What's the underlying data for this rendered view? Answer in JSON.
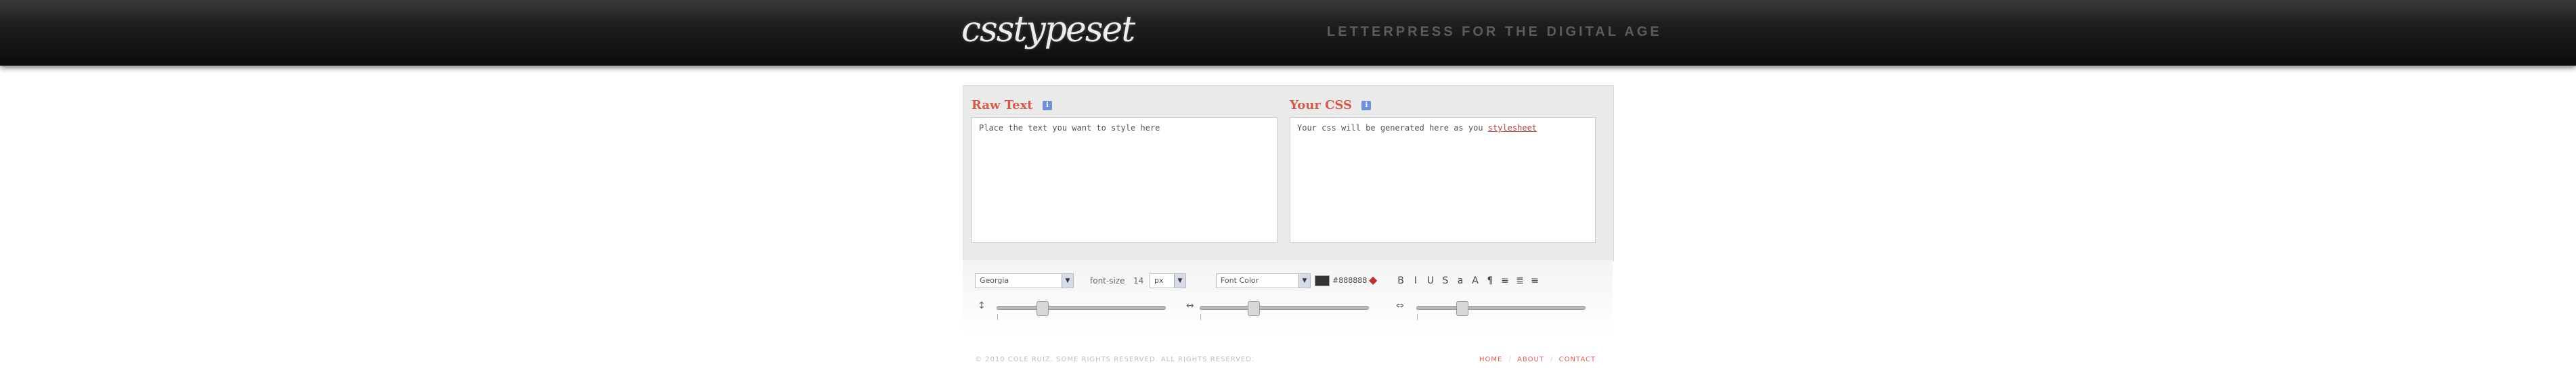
{
  "header": {
    "logo_text": "csstypeset",
    "tagline": "Letterpress for the digital age"
  },
  "editor": {
    "raw_label": "Raw Text",
    "raw_text": "Place the text you want to style here",
    "css_label": "Your CSS",
    "css_text_prefix": "Your css will be generated here as you",
    "css_text_link": "stylesheet",
    "help_icon": "info-icon"
  },
  "controls": {
    "font_family": "Georgia",
    "font_size_label": "font-size",
    "font_size_value": "14",
    "font_size_unit": "px",
    "text_color_select": "Font Color",
    "color_value": "#888888",
    "color_icon": "color-picker-icon",
    "format_buttons": [
      "B",
      "I",
      "U",
      "S",
      "a",
      "A",
      "¶",
      "≡",
      "≣",
      "≡"
    ],
    "slider1_icon": "line-height-icon",
    "slider2_icon": "letter-spacing-icon",
    "slider3_icon": "word-spacing-icon",
    "slider_levels": [
      0.25,
      0.3,
      0.25
    ]
  },
  "footer": {
    "copyright": "© 2010 Cole Ruiz. Some rights reserved. All rights reserved.",
    "links": [
      "Home",
      "About",
      "Contact"
    ]
  },
  "colors": {
    "accent_red": "#d65a4a",
    "header_dark": "#0b0b0b"
  }
}
